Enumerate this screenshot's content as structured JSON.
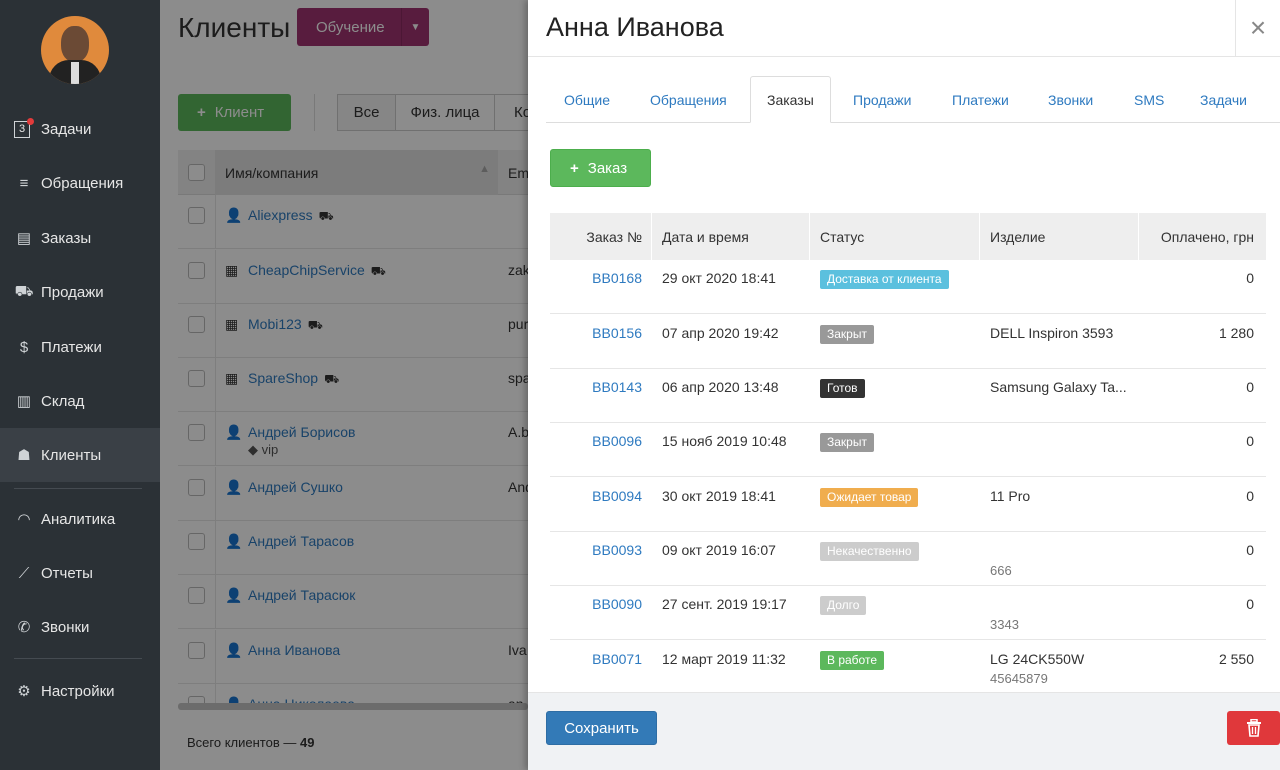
{
  "sidebar": {
    "task_count": "3",
    "items": [
      {
        "label": "Задачи",
        "icon": "tasks-icon"
      },
      {
        "label": "Обращения",
        "icon": "filter-icon"
      },
      {
        "label": "Заказы",
        "icon": "orders-icon"
      },
      {
        "label": "Продажи",
        "icon": "cart-icon"
      },
      {
        "label": "Платежи",
        "icon": "dollar-icon"
      },
      {
        "label": "Склад",
        "icon": "barcode-icon"
      },
      {
        "label": "Клиенты",
        "icon": "user-icon"
      },
      {
        "label": "Аналитика",
        "icon": "gauge-icon"
      },
      {
        "label": "Отчеты",
        "icon": "chart-icon"
      },
      {
        "label": "Звонки",
        "icon": "phone-icon"
      },
      {
        "label": "Настройки",
        "icon": "gear-icon"
      }
    ]
  },
  "main": {
    "title": "Клиенты",
    "edu_button": "Обучение",
    "add_client": "Клиент",
    "filters": [
      "Все",
      "Физ. лица",
      "Ко"
    ],
    "columns": {
      "name": "Имя/компания",
      "email": "Em"
    },
    "rows": [
      {
        "name": "Aliexpress",
        "email": "",
        "sub": ""
      },
      {
        "name": "CheapChipService",
        "email": "zak",
        "sub": ""
      },
      {
        "name": "Mobi123",
        "email": "pur",
        "sub": ""
      },
      {
        "name": "SpareShop",
        "email": "spa",
        "sub": ""
      },
      {
        "name": "Андрей Борисов",
        "email": "A.b",
        "sub": "vip"
      },
      {
        "name": "Андрей Сушко",
        "email": "And",
        "sub": ""
      },
      {
        "name": "Андрей Тарасов",
        "email": "",
        "sub": ""
      },
      {
        "name": "Андрей Тарасюк",
        "email": "",
        "sub": ""
      },
      {
        "name": "Анна Иванова",
        "email": "Iva",
        "sub": ""
      },
      {
        "name": "Анна Николаева",
        "email": "an",
        "sub": ""
      }
    ],
    "footer_label": "Всего клиентов —",
    "footer_count": "49"
  },
  "panel": {
    "title": "Анна Иванова",
    "close_symbol": "×",
    "tabs": [
      "Общие",
      "Обращения",
      "Заказы",
      "Продажи",
      "Платежи",
      "Звонки",
      "SMS",
      "Задачи"
    ],
    "active_tab": "Заказы",
    "add_order": "Заказ",
    "columns": {
      "num": "Заказ №",
      "date": "Дата и время",
      "status": "Статус",
      "item": "Изделие",
      "paid": "Оплачено, грн"
    },
    "orders": [
      {
        "num": "BB0168",
        "date": "29 окт 2020 18:41",
        "status": "Доставка от клиента",
        "status_color": "#5bc0de",
        "item": "",
        "serial": "",
        "paid": "0"
      },
      {
        "num": "BB0156",
        "date": "07 апр 2020 19:42",
        "status": "Закрыт",
        "status_color": "#999999",
        "item": "DELL Inspiron 3593",
        "serial": "",
        "paid": "1 280"
      },
      {
        "num": "BB0143",
        "date": "06 апр 2020 13:48",
        "status": "Готов",
        "status_color": "#333333",
        "item": "Samsung Galaxy Ta...",
        "serial": "",
        "paid": "0"
      },
      {
        "num": "BB0096",
        "date": "15 нояб 2019 10:48",
        "status": "Закрыт",
        "status_color": "#999999",
        "item": "",
        "serial": "",
        "paid": "0"
      },
      {
        "num": "BB0094",
        "date": "30 окт 2019 18:41",
        "status": "Ожидает товар",
        "status_color": "#f0ad4e",
        "item": "11 Pro",
        "serial": "",
        "paid": "0"
      },
      {
        "num": "BB0093",
        "date": "09 окт 2019 16:07",
        "status": "Некачественно",
        "status_color": "#cccccc",
        "item": "",
        "serial": "666",
        "paid": "0"
      },
      {
        "num": "BB0090",
        "date": "27 сент. 2019 19:17",
        "status": "Долго",
        "status_color": "#cccccc",
        "item": "",
        "serial": "3343",
        "paid": "0"
      },
      {
        "num": "BB0071",
        "date": "12 март 2019 11:32",
        "status": "В работе",
        "status_color": "#5cb85c",
        "item": "LG 24CK550W",
        "serial": "45645879",
        "paid": "2 550"
      }
    ],
    "save_label": "Сохранить"
  }
}
